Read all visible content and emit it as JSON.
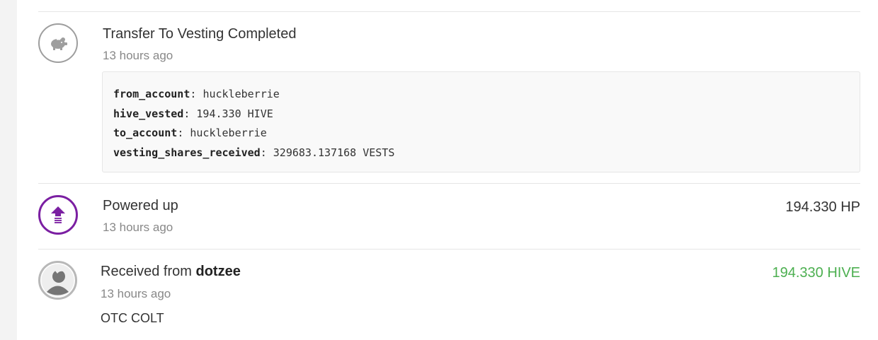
{
  "colors": {
    "gray_icon": "#9e9e9e",
    "purple_icon": "#7b1fa2",
    "positive_amount": "#4caf50"
  },
  "transactions": [
    {
      "icon": "piggy-bank-icon",
      "title": "Transfer To Vesting Completed",
      "time": "13 hours ago",
      "details": [
        {
          "key": "from_account",
          "sep": ": ",
          "value": "huckleberrie"
        },
        {
          "key": "hive_vested",
          "sep": ": ",
          "value": "194.330 HIVE"
        },
        {
          "key": "to_account",
          "sep": ": ",
          "value": "huckleberrie"
        },
        {
          "key": "vesting_shares_received",
          "sep": ": ",
          "value": "329683.137168 VESTS"
        }
      ]
    },
    {
      "icon": "power-up-icon",
      "title": "Powered up",
      "time": "13 hours ago",
      "amount": "194.330 HP"
    },
    {
      "icon": "user-avatar",
      "title_prefix": "Received from ",
      "title_user": "dotzee",
      "time": "13 hours ago",
      "amount": "194.330 HIVE",
      "memo": "OTC COLT"
    }
  ]
}
